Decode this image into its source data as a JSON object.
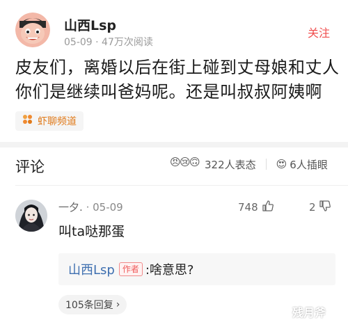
{
  "post": {
    "author": "山西Lsp",
    "date": "05-09",
    "dot": "·",
    "views": "47万次阅读",
    "follow_label": "关注",
    "text": "皮友们，离婚以后在街上碰到丈母娘和丈人你们是继续叫爸妈呢。还是叫叔叔阿姨啊",
    "channel": "虾聊频道"
  },
  "comments_section": {
    "heading": "评论",
    "reactions_text": "322人表态",
    "reaction_emojis": [
      "😠",
      "😢",
      "🙃"
    ],
    "views_emoji": "😍",
    "views_text": "6人插眼"
  },
  "comment": {
    "username": "一夕.",
    "dot": "·",
    "date": "05-09",
    "likes": "748",
    "dislikes": "2",
    "text": "叫ta哒那蛋",
    "reply": {
      "author": "山西Lsp",
      "badge": "作者",
      "text": ":啥意思?"
    },
    "replies_label": "105条回复",
    "replies_chevron": "›"
  },
  "watermark": "残月斧",
  "colors": {
    "accent": "#f04f4f",
    "link": "#3e6fb0",
    "channel": "#e07a1a",
    "muted": "#999999"
  },
  "icons": {
    "channel": "shrimp-icon",
    "like": "thumbs-up-icon",
    "dislike": "thumbs-down-icon"
  }
}
